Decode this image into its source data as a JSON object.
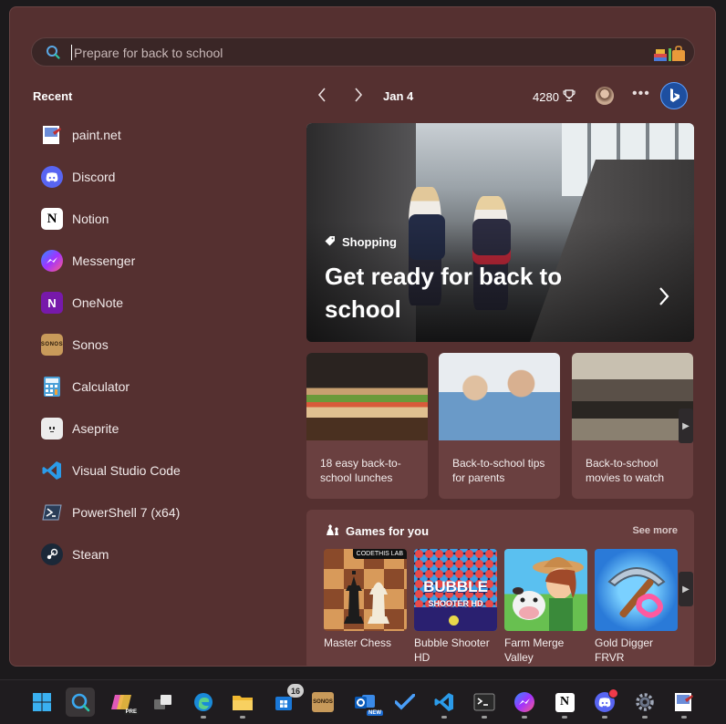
{
  "search": {
    "placeholder": "Prepare for back to school",
    "icon": "search-icon"
  },
  "recent": {
    "title": "Recent",
    "apps": [
      {
        "label": "paint.net",
        "icon": "paintnet-icon",
        "color": "#3a5fb0"
      },
      {
        "label": "Discord",
        "icon": "discord-icon",
        "color": "#5865f2"
      },
      {
        "label": "Notion",
        "icon": "notion-icon",
        "color": "#ffffff"
      },
      {
        "label": "Messenger",
        "icon": "messenger-icon",
        "color": "#a033ff"
      },
      {
        "label": "OneNote",
        "icon": "onenote-icon",
        "color": "#7719aa"
      },
      {
        "label": "Sonos",
        "icon": "sonos-icon",
        "color": "#c89a5a"
      },
      {
        "label": "Calculator",
        "icon": "calculator-icon",
        "color": "#4aa0d8"
      },
      {
        "label": "Aseprite",
        "icon": "aseprite-icon",
        "color": "#e8e8e8"
      },
      {
        "label": "Visual Studio Code",
        "icon": "vscode-icon",
        "color": "#2b9be9"
      },
      {
        "label": "PowerShell 7 (x64)",
        "icon": "powershell-icon",
        "color": "#2a3a50"
      },
      {
        "label": "Steam",
        "icon": "steam-icon",
        "color": "#1b2838"
      }
    ]
  },
  "header": {
    "date": "Jan 4",
    "points": "4280"
  },
  "hero": {
    "category": "Shopping",
    "headline": "Get ready for back to school"
  },
  "cards": [
    {
      "label": "18 easy back-to-school lunches"
    },
    {
      "label": "Back-to-school tips for parents"
    },
    {
      "label": "Back-to-school movies to watch"
    }
  ],
  "games": {
    "title": "Games for you",
    "see_more": "See more",
    "items": [
      {
        "label": "Master Chess",
        "badge": "CODETHIS LAB"
      },
      {
        "label": "Bubble Shooter HD",
        "art_title": "BUBBLE",
        "art_subtitle": "SHOOTER HD"
      },
      {
        "label": "Farm Merge Valley"
      },
      {
        "label": "Gold Digger FRVR"
      }
    ]
  },
  "taskbar": {
    "badge_count": "16",
    "sonos_label": "SONOS",
    "pre_label": "PRE",
    "new_label": "NEW"
  }
}
